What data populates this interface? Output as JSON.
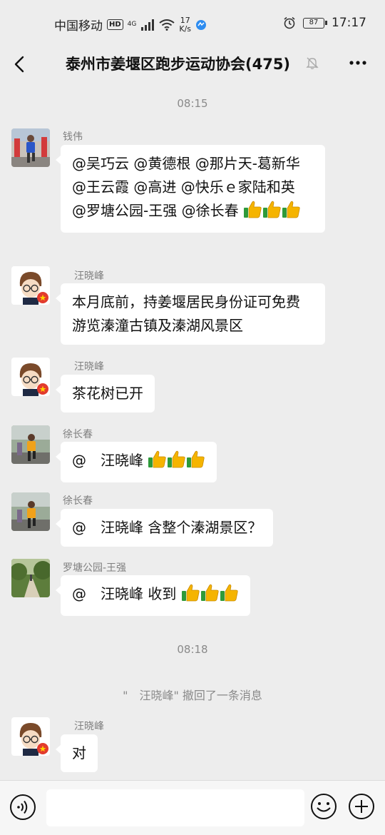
{
  "status_bar": {
    "carrier": "中国移动",
    "hd": "HD",
    "network": "4G",
    "speed_value": "17",
    "speed_unit": "K/s",
    "battery": "87",
    "time": "17:17"
  },
  "header": {
    "title": "泰州市姜堰区跑步运动协会(475)"
  },
  "messages": [
    {
      "type": "time",
      "text": "08:15"
    },
    {
      "type": "chat",
      "sender": "钱伟",
      "avatar": "runner-blue-photo",
      "text": "@吴巧云 @黄德根 @那片天-葛新华 @王云霞 @高进 @快乐ｅ家陆和英 @罗塘公园-王强 @徐长春",
      "thumbs": 3
    },
    {
      "type": "chat",
      "sender": "汪晓峰",
      "avatar": "cartoon-boy-glasses",
      "text": "本月底前，持姜堰居民身份证可免费游览溱潼古镇及溱湖风景区"
    },
    {
      "type": "chat",
      "sender": "汪晓峰",
      "avatar": "cartoon-boy-glasses",
      "text": "茶花树已开"
    },
    {
      "type": "chat",
      "sender": "徐长春",
      "avatar": "runner-orange-photo",
      "text": "@　汪晓峰 ",
      "thumbs": 3
    },
    {
      "type": "chat",
      "sender": "徐长春",
      "avatar": "runner-orange-photo",
      "text": "@　汪晓峰 含整个溱湖景区？"
    },
    {
      "type": "chat",
      "sender": "罗塘公园-王强",
      "avatar": "park-path-photo",
      "text": "@　汪晓峰 收到",
      "thumbs": 3
    },
    {
      "type": "time",
      "text": "08:18"
    },
    {
      "type": "system",
      "text": "\"　汪晓峰\" 撤回了一条消息"
    },
    {
      "type": "chat",
      "sender": "汪晓峰",
      "avatar": "cartoon-boy-glasses",
      "text": "对"
    }
  ],
  "input": {
    "placeholder": ""
  },
  "colors": {
    "background": "#ededed",
    "bubble": "#ffffff",
    "muted_text": "#8a8a8a",
    "thumbs_yellow": "#f5b400",
    "thumbs_green": "#2e9a3a"
  }
}
